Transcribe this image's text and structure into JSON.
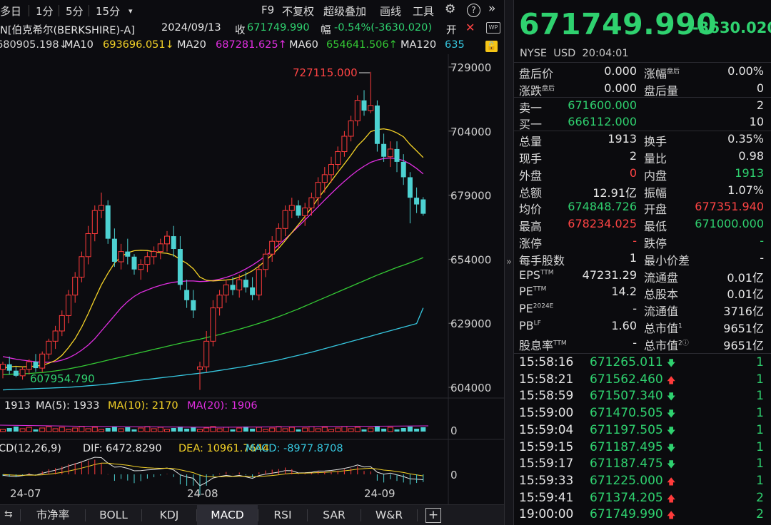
{
  "toolbar": {
    "items": [
      "多日",
      "1分",
      "5分",
      "15分",
      "▾",
      "F9",
      "不复权",
      "超级叠加",
      "画线",
      "工具",
      "⚙",
      "?",
      "»"
    ]
  },
  "header": {
    "name": "N[伯克希尔(BERKSHIRE)-A]",
    "date": "2024/09/13",
    "close_label": "收",
    "close_value": "671749.990",
    "change_label": "幅",
    "change_value": "-0.54%(-3630.020)",
    "open_label": "开",
    "close_icon": "close-icon",
    "share_icon": "share-icon",
    "lock_icon": "lock-icon"
  },
  "ma_legend": [
    {
      "label": "",
      "value": "680905.198↓",
      "color": "#ffffff"
    },
    {
      "label": "MA10",
      "value": "693696.051↓",
      "color": "#f5d327"
    },
    {
      "label": "MA20",
      "value": "687281.625↑",
      "color": "#e02ee0"
    },
    {
      "label": "MA60",
      "value": "654641.506↑",
      "color": "#34c934"
    },
    {
      "label": "MA120",
      "value": "635",
      "color": "#36c8e0"
    }
  ],
  "price_axis": [
    "729000",
    "704000",
    "679000",
    "654000",
    "629000",
    "604000"
  ],
  "annotations": {
    "high": "727115.000",
    "low": "607954.790"
  },
  "volume": {
    "legend": "1913",
    "ma5": "MA(5): 1933",
    "ma10": "MA(10): 2170",
    "ma20": "MA(20): 1906",
    "axis_zero": "0"
  },
  "macd": {
    "legend_name": "CD(12,26,9)",
    "dif": "DIF: 6472.8290",
    "dea": "DEA: 10961.7644",
    "macd": "MACD: -8977.8708",
    "axis_zero": "0"
  },
  "date_axis": [
    "24-07",
    "24-08",
    "24-09"
  ],
  "tabs": [
    "市净率",
    "BOLL",
    "KDJ",
    "MACD",
    "RSI",
    "SAR",
    "W&R",
    "+"
  ],
  "active_tab": "MACD",
  "quote": {
    "price": "671749.990",
    "change": "-3630.020",
    "market": "NYSE",
    "currency": "USD",
    "time": "20:04:01"
  },
  "stats": [
    {
      "l1": "盘后价",
      "v1": "0.000",
      "c1": "w",
      "l2": "涨幅",
      "s2": "盘后",
      "v2": "0.00%",
      "c2": "w"
    },
    {
      "l1": "涨跌",
      "s1": "盘后",
      "v1": "0.000",
      "c1": "w",
      "l2": "盘后量",
      "v2": "0",
      "c2": "w"
    },
    {
      "l1": "卖一",
      "v1": "671600.000",
      "c1": "g",
      "l2": "",
      "v2": "2",
      "c2": "w"
    },
    {
      "l1": "买一",
      "v1": "666112.000",
      "c1": "g",
      "l2": "",
      "v2": "10",
      "c2": "w"
    },
    {
      "l1": "总量",
      "v1": "1913",
      "c1": "w",
      "l2": "换手",
      "v2": "0.35%",
      "c2": "w"
    },
    {
      "l1": "现手",
      "v1": "2",
      "c1": "w",
      "l2": "量比",
      "v2": "0.98",
      "c2": "w"
    },
    {
      "l1": "外盘",
      "v1": "0",
      "c1": "r",
      "l2": "内盘",
      "v2": "1913",
      "c2": "g"
    },
    {
      "l1": "总额",
      "v1": "12.91亿",
      "c1": "w",
      "l2": "振幅",
      "v2": "1.07%",
      "c2": "w"
    },
    {
      "l1": "均价",
      "v1": "674848.726",
      "c1": "g",
      "l2": "开盘",
      "v2": "677351.940",
      "c2": "r"
    },
    {
      "l1": "最高",
      "v1": "678234.025",
      "c1": "r",
      "l2": "最低",
      "v2": "671000.000",
      "c2": "g"
    },
    {
      "l1": "涨停",
      "v1": "-",
      "c1": "r",
      "l2": "跌停",
      "v2": "-",
      "c2": "g"
    },
    {
      "l1": "每手股数",
      "v1": "1",
      "c1": "w",
      "l2": "最小价差",
      "v2": "-",
      "c2": "w"
    },
    {
      "l1": "EPS",
      "s1": "TTM",
      "v1": "47231.29",
      "c1": "w",
      "l2": "流通盘",
      "v2": "0.01亿",
      "c2": "w"
    },
    {
      "l1": "PE",
      "s1": "TTM",
      "v1": "14.2",
      "c1": "w",
      "l2": "总股本",
      "v2": "0.01亿",
      "c2": "w"
    },
    {
      "l1": "PE",
      "s1": "2024E",
      "v1": "-",
      "c1": "w",
      "l2": "流通值",
      "v2": "3716亿",
      "c2": "w"
    },
    {
      "l1": "PB",
      "s1": "LF",
      "v1": "1.60",
      "c1": "w",
      "l2": "总市值",
      "s2": "1",
      "v2": "9651亿",
      "c2": "w"
    },
    {
      "l1": "股息率",
      "s1": "TTM",
      "v1": "-",
      "c1": "w",
      "l2": "总市值",
      "s2": "2ⓘ",
      "v2": "9651亿",
      "c2": "w"
    }
  ],
  "trades": [
    {
      "time": "15:58:16",
      "price": "671265.011",
      "dir": "down",
      "qty": "1"
    },
    {
      "time": "15:58:21",
      "price": "671562.460",
      "dir": "up",
      "qty": "1"
    },
    {
      "time": "15:58:59",
      "price": "671507.340",
      "dir": "down",
      "qty": "1"
    },
    {
      "time": "15:59:00",
      "price": "671470.505",
      "dir": "down",
      "qty": "1"
    },
    {
      "time": "15:59:04",
      "price": "671197.505",
      "dir": "down",
      "qty": "1"
    },
    {
      "time": "15:59:15",
      "price": "671187.495",
      "dir": "down",
      "qty": "1"
    },
    {
      "time": "15:59:17",
      "price": "671187.475",
      "dir": "down",
      "qty": "1"
    },
    {
      "time": "15:59:33",
      "price": "671225.000",
      "dir": "up",
      "qty": "1"
    },
    {
      "time": "15:59:41",
      "price": "671374.205",
      "dir": "up",
      "qty": "2"
    },
    {
      "time": "19:00:00",
      "price": "671749.990",
      "dir": "up",
      "qty": "2"
    }
  ],
  "colors": {
    "up": "#ff3b3b",
    "down": "#4dd2d2",
    "green": "#2fd16f",
    "ma5": "#ffffff",
    "ma10": "#f5d327",
    "ma20": "#e02ee0",
    "ma60": "#34c934",
    "ma120": "#36c8e0"
  },
  "chart_data": {
    "type": "candlestick",
    "price_unit": "USD",
    "ylim": [
      604000,
      729000
    ],
    "yticks": [
      729000,
      704000,
      679000,
      654000,
      629000,
      604000
    ],
    "x_labels": [
      "24-07",
      "24-08",
      "24-09"
    ],
    "candles": [
      {
        "o": 611000,
        "h": 614000,
        "l": 607500,
        "c": 613000
      },
      {
        "o": 613000,
        "h": 616000,
        "l": 609000,
        "c": 610500
      },
      {
        "o": 610500,
        "h": 612000,
        "l": 607954.79,
        "c": 608500
      },
      {
        "o": 608500,
        "h": 612000,
        "l": 607000,
        "c": 611000
      },
      {
        "o": 611000,
        "h": 615000,
        "l": 609000,
        "c": 614000
      },
      {
        "o": 614000,
        "h": 617000,
        "l": 610000,
        "c": 611500
      },
      {
        "o": 611500,
        "h": 618000,
        "l": 610000,
        "c": 617000
      },
      {
        "o": 617000,
        "h": 623000,
        "l": 615000,
        "c": 622000
      },
      {
        "o": 622000,
        "h": 628000,
        "l": 619000,
        "c": 626000
      },
      {
        "o": 626000,
        "h": 634000,
        "l": 624000,
        "c": 632000
      },
      {
        "o": 632000,
        "h": 642000,
        "l": 629000,
        "c": 640000
      },
      {
        "o": 640000,
        "h": 649000,
        "l": 637000,
        "c": 647000
      },
      {
        "o": 647000,
        "h": 657000,
        "l": 645000,
        "c": 655000
      },
      {
        "o": 655000,
        "h": 667000,
        "l": 652000,
        "c": 664000
      },
      {
        "o": 664000,
        "h": 675000,
        "l": 661000,
        "c": 673000
      },
      {
        "o": 673000,
        "h": 680000,
        "l": 670000,
        "c": 675000
      },
      {
        "o": 675000,
        "h": 677000,
        "l": 660000,
        "c": 662000
      },
      {
        "o": 662000,
        "h": 666000,
        "l": 651000,
        "c": 653000
      },
      {
        "o": 653000,
        "h": 660000,
        "l": 650000,
        "c": 657000
      },
      {
        "o": 657000,
        "h": 662000,
        "l": 652000,
        "c": 655000
      },
      {
        "o": 655000,
        "h": 656000,
        "l": 648000,
        "c": 650000
      },
      {
        "o": 650000,
        "h": 654000,
        "l": 646000,
        "c": 652000
      },
      {
        "o": 652000,
        "h": 657000,
        "l": 649000,
        "c": 655000
      },
      {
        "o": 655000,
        "h": 659000,
        "l": 652000,
        "c": 657000
      },
      {
        "o": 657000,
        "h": 662000,
        "l": 654000,
        "c": 660000
      },
      {
        "o": 660000,
        "h": 665000,
        "l": 657000,
        "c": 663000
      },
      {
        "o": 663000,
        "h": 667000,
        "l": 655000,
        "c": 658000
      },
      {
        "o": 658000,
        "h": 663000,
        "l": 642000,
        "c": 644000
      },
      {
        "o": 642000,
        "h": 646000,
        "l": 635000,
        "c": 638000
      },
      {
        "o": 638000,
        "h": 642000,
        "l": 631000,
        "c": 634000
      },
      {
        "o": 611000,
        "h": 614000,
        "l": 603000,
        "c": 612000
      },
      {
        "o": 612000,
        "h": 626000,
        "l": 610000,
        "c": 622000
      },
      {
        "o": 622000,
        "h": 638000,
        "l": 620000,
        "c": 635000
      },
      {
        "o": 635000,
        "h": 642000,
        "l": 632000,
        "c": 640000
      },
      {
        "o": 640000,
        "h": 646000,
        "l": 637000,
        "c": 644000
      },
      {
        "o": 644000,
        "h": 647000,
        "l": 640000,
        "c": 642000
      },
      {
        "o": 642000,
        "h": 648000,
        "l": 639000,
        "c": 646000
      },
      {
        "o": 646000,
        "h": 649000,
        "l": 641000,
        "c": 643000
      },
      {
        "o": 643000,
        "h": 647000,
        "l": 638000,
        "c": 640000
      },
      {
        "o": 640000,
        "h": 652000,
        "l": 638000,
        "c": 650000
      },
      {
        "o": 650000,
        "h": 658000,
        "l": 647000,
        "c": 656000
      },
      {
        "o": 656000,
        "h": 663000,
        "l": 653000,
        "c": 661000
      },
      {
        "o": 661000,
        "h": 668000,
        "l": 658000,
        "c": 666000
      },
      {
        "o": 666000,
        "h": 675000,
        "l": 663000,
        "c": 673000
      },
      {
        "o": 673000,
        "h": 678000,
        "l": 670000,
        "c": 675000
      },
      {
        "o": 675000,
        "h": 677000,
        "l": 670000,
        "c": 671000
      },
      {
        "o": 671000,
        "h": 676000,
        "l": 667000,
        "c": 674000
      },
      {
        "o": 674000,
        "h": 680000,
        "l": 671000,
        "c": 678000
      },
      {
        "o": 678000,
        "h": 686000,
        "l": 675000,
        "c": 684000
      },
      {
        "o": 684000,
        "h": 690000,
        "l": 680000,
        "c": 687000
      },
      {
        "o": 687000,
        "h": 694000,
        "l": 684000,
        "c": 691000
      },
      {
        "o": 691000,
        "h": 698000,
        "l": 689000,
        "c": 696000
      },
      {
        "o": 696000,
        "h": 704000,
        "l": 694000,
        "c": 702000
      },
      {
        "o": 702000,
        "h": 710000,
        "l": 700000,
        "c": 708000
      },
      {
        "o": 708000,
        "h": 718000,
        "l": 706000,
        "c": 716000
      },
      {
        "o": 716000,
        "h": 720000,
        "l": 710000,
        "c": 712000
      },
      {
        "o": 712000,
        "h": 727115,
        "l": 711000,
        "c": 714000
      },
      {
        "o": 714000,
        "h": 716000,
        "l": 696000,
        "c": 699000
      },
      {
        "o": 699000,
        "h": 703000,
        "l": 692000,
        "c": 694000
      },
      {
        "o": 694000,
        "h": 700000,
        "l": 690000,
        "c": 697000
      },
      {
        "o": 697000,
        "h": 700000,
        "l": 688000,
        "c": 692000
      },
      {
        "o": 692000,
        "h": 695000,
        "l": 683000,
        "c": 686000
      },
      {
        "o": 686000,
        "h": 688000,
        "l": 668000,
        "c": 678000
      },
      {
        "o": 678000,
        "h": 682000,
        "l": 672000,
        "c": 675380
      },
      {
        "o": 677352,
        "h": 678234,
        "l": 671000,
        "c": 671750
      }
    ],
    "ma10": [
      611500,
      612000,
      612200,
      612000,
      612100,
      612300,
      612600,
      613400,
      614500,
      616500,
      619500,
      623000,
      627500,
      632800,
      638500,
      644000,
      648500,
      652500,
      655000,
      656500,
      657300,
      657500,
      657400,
      656900,
      656500,
      656300,
      655600,
      653900,
      652400,
      650300,
      647000,
      645800,
      645500,
      645700,
      645900,
      646200,
      647000,
      648100,
      649500,
      651300,
      653400,
      655800,
      658300,
      661300,
      664400,
      667500,
      670700,
      674100,
      677700,
      681100,
      684500,
      687900,
      691200,
      694600,
      698200,
      700800,
      703800,
      704600,
      704900,
      704400,
      703300,
      701800,
      698800,
      696300,
      693700
    ],
    "ma20": [
      616000,
      615500,
      615000,
      614600,
      614300,
      614000,
      613800,
      613800,
      614000,
      614600,
      615500,
      616800,
      618500,
      620500,
      623000,
      626000,
      629000,
      632000,
      635000,
      637500,
      639500,
      641000,
      642000,
      643000,
      643800,
      644500,
      645000,
      645300,
      645500,
      645500,
      645300,
      645400,
      645700,
      646200,
      646900,
      647800,
      648900,
      650200,
      651700,
      653400,
      655300,
      657400,
      659600,
      661900,
      664300,
      666800,
      669300,
      671900,
      674500,
      677100,
      679600,
      682100,
      684400,
      686600,
      688600,
      690300,
      691800,
      692700,
      693300,
      693500,
      693200,
      692500,
      691200,
      689400,
      687300
    ],
    "ma60": [
      609000,
      609100,
      609200,
      609300,
      609400,
      609600,
      609800,
      610100,
      610400,
      610800,
      611200,
      611700,
      612200,
      612800,
      613400,
      614000,
      614600,
      615200,
      615800,
      616400,
      617000,
      617600,
      618200,
      618800,
      619400,
      620000,
      620600,
      621200,
      621800,
      622300,
      622800,
      623400,
      624000,
      624600,
      625300,
      626000,
      626700,
      627400,
      628200,
      629000,
      629800,
      630700,
      631600,
      632600,
      633600,
      634600,
      635700,
      636800,
      637900,
      639000,
      640100,
      641200,
      642300,
      643400,
      644500,
      645600,
      646700,
      647800,
      648800,
      649800,
      650800,
      651700,
      652600,
      653600,
      654640
    ],
    "ma120": [
      603000,
      603100,
      603200,
      603300,
      603400,
      603500,
      603600,
      603700,
      603800,
      603900,
      604000,
      604200,
      604400,
      604600,
      604800,
      605000,
      605300,
      605600,
      605900,
      606200,
      606500,
      606800,
      607100,
      607400,
      607700,
      608000,
      608300,
      608600,
      608900,
      609200,
      609500,
      609800,
      610200,
      610600,
      611000,
      611400,
      611800,
      612200,
      612700,
      613200,
      613700,
      614200,
      614700,
      615300,
      615900,
      616500,
      617100,
      617700,
      618400,
      619100,
      619800,
      620500,
      621200,
      621900,
      622600,
      623300,
      624000,
      624700,
      625400,
      626100,
      626800,
      627500,
      628200,
      628900,
      635000
    ],
    "volume_ma": {
      "ma5": 1933,
      "ma10": 2170,
      "ma20": 1906,
      "last": 1913
    },
    "macd_values": {
      "dif": 6472.829,
      "dea": 10961.7644,
      "macd": -8977.8708
    }
  }
}
